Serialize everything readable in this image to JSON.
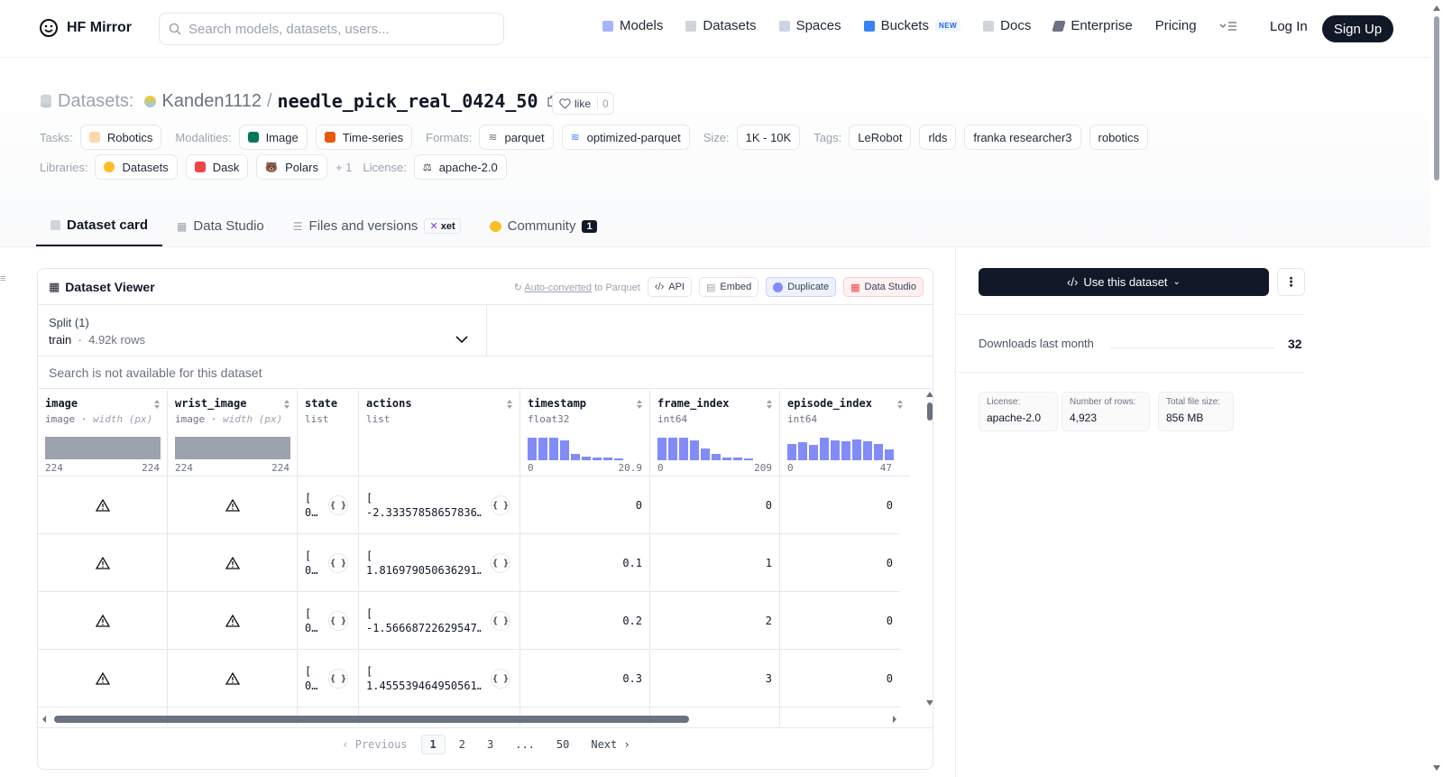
{
  "nav": {
    "brand": "HF Mirror",
    "search_placeholder": "Search models, datasets, users...",
    "items": [
      {
        "label": "Models",
        "icon": "cube-icon"
      },
      {
        "label": "Datasets",
        "icon": "database-icon"
      },
      {
        "label": "Spaces",
        "icon": "grid-icon"
      },
      {
        "label": "Buckets",
        "icon": "bucket-icon",
        "badge": "NEW"
      },
      {
        "label": "Docs",
        "icon": "book-icon"
      },
      {
        "label": "Enterprise",
        "icon": "enterprise-icon"
      },
      {
        "label": "Pricing"
      }
    ],
    "login": "Log In",
    "signup": "Sign Up"
  },
  "header": {
    "section": "Datasets:",
    "owner": "Kanden1112",
    "sep": "/",
    "repo": "needle_pick_real_0424_50",
    "like_label": "like",
    "like_count": "0",
    "tasks_label": "Tasks:",
    "tasks": [
      "Robotics"
    ],
    "modalities_label": "Modalities:",
    "modalities": [
      "Image",
      "Time-series"
    ],
    "formats_label": "Formats:",
    "formats": [
      "parquet",
      "optimized-parquet"
    ],
    "size_label": "Size:",
    "size": "1K - 10K",
    "tags_label": "Tags:",
    "tags": [
      "LeRobot",
      "rlds",
      "franka researcher3",
      "robotics"
    ],
    "libraries_label": "Libraries:",
    "libraries": [
      "Datasets",
      "Dask",
      "Polars"
    ],
    "libraries_more": "+ 1",
    "license_label": "License:",
    "license": "apache-2.0"
  },
  "tabs": [
    {
      "label": "Dataset card",
      "active": true
    },
    {
      "label": "Data Studio"
    },
    {
      "label": "Files and versions",
      "badge": "xet"
    },
    {
      "label": "Community",
      "count": "1"
    }
  ],
  "viewer": {
    "title": "Dataset Viewer",
    "auto_converted_link": "Auto-converted",
    "auto_converted_rest": " to Parquet",
    "buttons": {
      "api": "API",
      "embed": "Embed",
      "duplicate": "Duplicate",
      "data_studio": "Data Studio"
    },
    "split_label": "Split (1)",
    "split_name": "train",
    "split_rows": "4.92k rows",
    "search_note": "Search is not available for this dataset",
    "columns": [
      {
        "name": "image",
        "type": "image",
        "subtype": "width (px)",
        "min": "224",
        "max": "224"
      },
      {
        "name": "wrist_image",
        "type": "image",
        "subtype": "width (px)",
        "min": "224",
        "max": "224"
      },
      {
        "name": "state",
        "type": "list"
      },
      {
        "name": "actions",
        "type": "list"
      },
      {
        "name": "timestamp",
        "type": "float32",
        "min": "0",
        "max": "20.9",
        "hist": [
          0.95,
          0.95,
          0.95,
          0.85,
          0.25,
          0.15,
          0.1,
          0.1,
          0.08
        ]
      },
      {
        "name": "frame_index",
        "type": "int64",
        "min": "0",
        "max": "209",
        "hist": [
          0.95,
          0.95,
          0.95,
          0.85,
          0.5,
          0.25,
          0.12,
          0.1,
          0.08
        ]
      },
      {
        "name": "episode_index",
        "type": "int64",
        "min": "0",
        "max": "47",
        "hist": [
          0.7,
          0.75,
          0.65,
          0.95,
          0.85,
          0.8,
          0.9,
          0.8,
          0.7,
          0.45
        ]
      }
    ],
    "rows": [
      {
        "state": "[\n0…",
        "actions": "[\n-2.33357858657836…",
        "timestamp": "0",
        "frame_index": "0",
        "episode_index": "0"
      },
      {
        "state": "[\n0…",
        "actions": "[\n1.816979050636291…",
        "timestamp": "0.1",
        "frame_index": "1",
        "episode_index": "0"
      },
      {
        "state": "[\n0…",
        "actions": "[\n-1.56668722629547…",
        "timestamp": "0.2",
        "frame_index": "2",
        "episode_index": "0"
      },
      {
        "state": "[\n0…",
        "actions": "[\n1.455539464950561…",
        "timestamp": "0.3",
        "frame_index": "3",
        "episode_index": "0"
      }
    ],
    "pager": {
      "prev": "‹ Previous",
      "pages": [
        "1",
        "2",
        "3",
        "...",
        "50"
      ],
      "next": "Next ›"
    }
  },
  "sidebar": {
    "use_button": "Use this dataset",
    "downloads_label": "Downloads last month",
    "downloads_value": "32",
    "license_label": "License:",
    "license_value": "apache-2.0",
    "rows_label": "Number of rows:",
    "rows_value": "4,923",
    "size_label": "Total file size:",
    "size_value": "856 MB"
  },
  "colors": {
    "accent": "#111827",
    "hist": "#818cf8",
    "image_bar": "#9ca3af"
  }
}
